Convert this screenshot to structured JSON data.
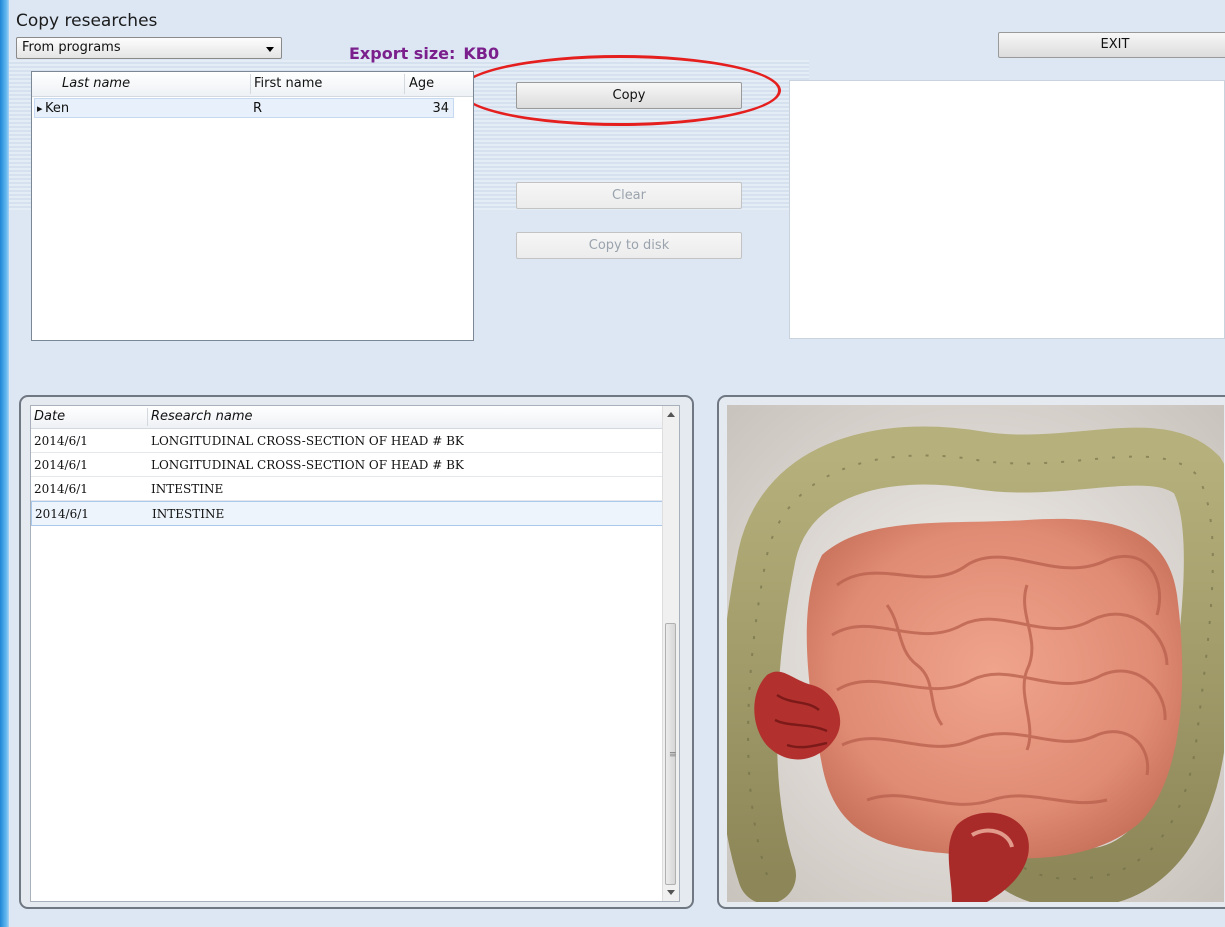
{
  "window": {
    "title": "Copy researches"
  },
  "source_select": {
    "value": "From programs"
  },
  "export": {
    "label": "Export size:",
    "value": "KB0"
  },
  "buttons": {
    "exit": "EXIT",
    "copy": "Copy",
    "clear": "Clear",
    "copy_to_disk": "Copy to disk"
  },
  "patients": {
    "columns": [
      "Last name",
      "First name",
      "Age"
    ],
    "rows": [
      {
        "last_name": "Ken",
        "first_name": "R",
        "age": "34"
      }
    ]
  },
  "researches": {
    "columns": [
      "Date",
      "Research name"
    ],
    "rows": [
      {
        "date": "2014/6/1",
        "name": "LONGITUDINAL CROSS-SECTION OF HEAD # BK"
      },
      {
        "date": "2014/6/1",
        "name": "LONGITUDINAL CROSS-SECTION OF HEAD # BK"
      },
      {
        "date": "2014/6/1",
        "name": "INTESTINE"
      },
      {
        "date": "2014/6/1",
        "name": "INTESTINE"
      }
    ],
    "selected_row": 4
  },
  "colors": {
    "accent_export": "#7a1f8c",
    "highlight_ring": "#e51e1e"
  },
  "preview_image": {
    "subject": "intestine-illustration"
  }
}
